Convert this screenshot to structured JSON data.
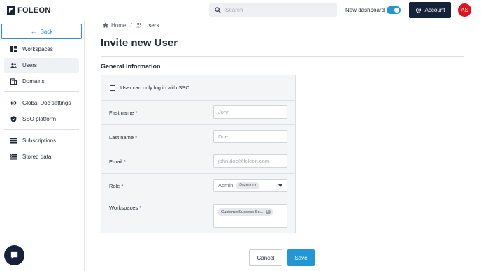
{
  "brand": {
    "name": "FOLEON"
  },
  "search": {
    "placeholder": "Search"
  },
  "header": {
    "new_dashboard_label": "New dashboard",
    "new_dashboard_on": true,
    "account_label": "Account",
    "avatar_initials": "AS"
  },
  "sidebar": {
    "back_label": "Back",
    "items": [
      {
        "label": "Workspaces",
        "icon": "dashboard-icon"
      },
      {
        "label": "Users",
        "icon": "users-icon",
        "active": true
      },
      {
        "label": "Domains",
        "icon": "domain-icon"
      },
      {
        "label": "Global Doc settings",
        "icon": "gear-icon"
      },
      {
        "label": "SSO platform",
        "icon": "shield-icon"
      },
      {
        "label": "Subscriptions",
        "icon": "list-icon"
      },
      {
        "label": "Stored data",
        "icon": "database-icon"
      }
    ]
  },
  "breadcrumb": {
    "home": "Home",
    "separator": "/",
    "current": "Users"
  },
  "page": {
    "title": "Invite new User",
    "section_title": "General information"
  },
  "form": {
    "sso_label": "User can only log in with SSO",
    "sso_checked": false,
    "first_name": {
      "label": "First name *",
      "placeholder": "John",
      "value": ""
    },
    "last_name": {
      "label": "Last name *",
      "placeholder": "Doe",
      "value": ""
    },
    "email": {
      "label": "Email *",
      "placeholder": "john.doe@foleon.com",
      "value": ""
    },
    "role": {
      "label": "Role *",
      "value": "Admin",
      "badge": "Premium"
    },
    "workspaces": {
      "label": "Workspaces *",
      "chips": [
        "CustomerSuccess So..."
      ]
    }
  },
  "footer": {
    "cancel_label": "Cancel",
    "save_label": "Save"
  },
  "colors": {
    "accent": "#2396d6",
    "navy": "#15223a",
    "avatar": "#e0131e"
  }
}
